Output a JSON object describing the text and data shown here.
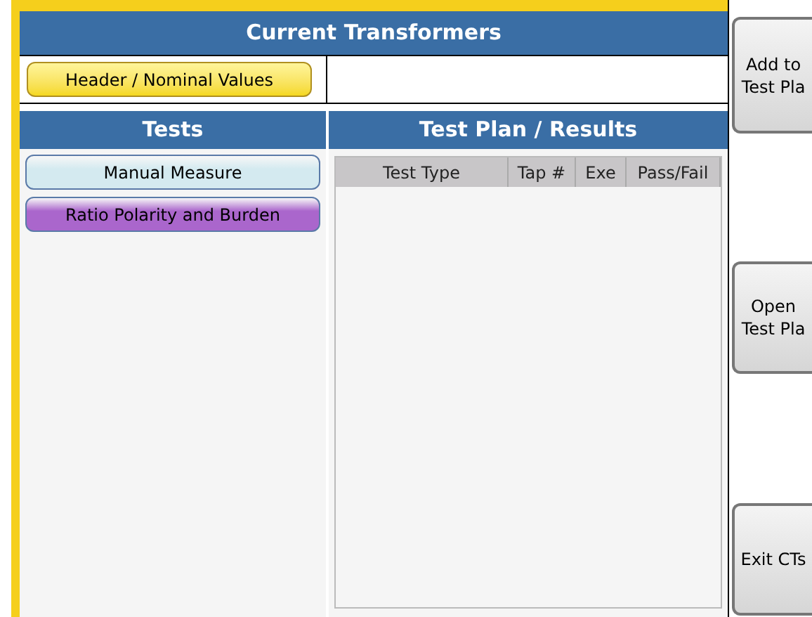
{
  "title": "Current Transformers",
  "header_button": {
    "label": "Header / Nominal Values"
  },
  "tests_panel": {
    "title": "Tests",
    "items": [
      {
        "label": "Manual Measure",
        "color": "#d4eaf0"
      },
      {
        "label": "Ratio Polarity and Burden",
        "color": "#aa66cc"
      }
    ]
  },
  "plan_panel": {
    "title": "Test Plan / Results",
    "table": {
      "columns": [
        "Test Type",
        "Tap #",
        "Exe",
        "Pass/Fail"
      ]
    }
  },
  "side_buttons": [
    {
      "lines": [
        "Add to",
        "Test Pla"
      ]
    },
    {
      "lines": [
        "Open",
        "Test Pla"
      ]
    },
    {
      "lines": [
        "Exit CTs"
      ]
    }
  ]
}
